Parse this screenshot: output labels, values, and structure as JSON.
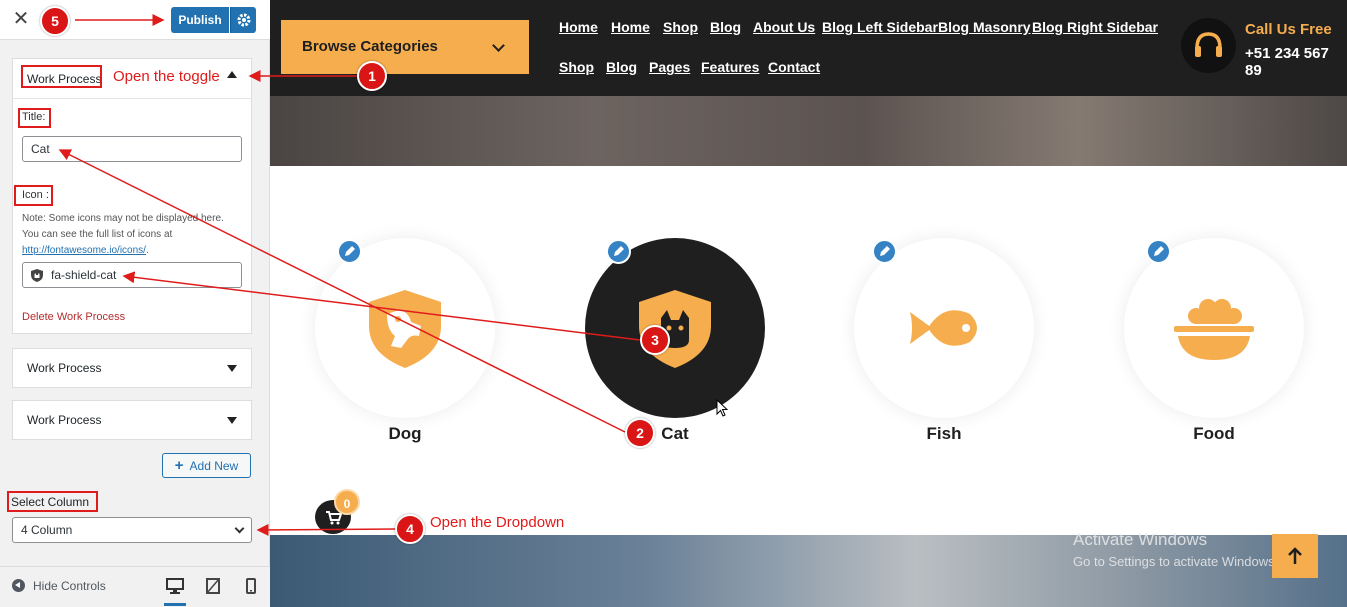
{
  "panel": {
    "close_glyph": "✕",
    "publish_label": "Publish",
    "open_section": {
      "title": "Work Process",
      "title_label": "Title:",
      "title_value": "Cat",
      "icon_label": "Icon :",
      "note_line1": "Note: Some icons may not be displayed here.",
      "note_line2": "You can see the full list of icons at",
      "note_link": "http://fontawesome.io/icons/",
      "note_link_suffix": ".",
      "icon_value": "fa-shield-cat",
      "delete_label": "Delete Work Process"
    },
    "collapsed_sections": [
      "Work Process",
      "Work Process"
    ],
    "add_new_label": "Add New",
    "select_column_label": "Select Column",
    "select_column_value": "4 Column",
    "hide_controls_label": "Hide Controls"
  },
  "site": {
    "browse_categories": "Browse Categories",
    "nav_row1": [
      "Home",
      "Home",
      "Shop",
      "Blog",
      "About Us",
      "Blog Left Sidebar",
      "Blog Masonry",
      "Blog Right Sidebar"
    ],
    "nav_row2": [
      "Shop",
      "Blog",
      "Pages",
      "Features",
      "Contact"
    ],
    "call_label": "Call Us Free",
    "call_number": "+51 234 567 89",
    "categories": [
      {
        "name": "Dog",
        "icon": "shield-dog-icon"
      },
      {
        "name": "Cat",
        "icon": "shield-cat-icon"
      },
      {
        "name": "Fish",
        "icon": "fish-icon"
      },
      {
        "name": "Food",
        "icon": "bowl-food-icon"
      }
    ],
    "cart_count": "0",
    "watermark_line1": "Activate Windows",
    "watermark_line2": "Go to Settings to activate Windows."
  },
  "annotations": [
    {
      "number": "1",
      "text": "Open the toggle"
    },
    {
      "number": "2",
      "text": ""
    },
    {
      "number": "3",
      "text": ""
    },
    {
      "number": "4",
      "text": "Open the Dropdown"
    },
    {
      "number": "5",
      "text": ""
    }
  ],
  "colors": {
    "accent_orange": "#f6ad4e",
    "dark": "#1f1f1f",
    "wp_blue": "#2271b1",
    "annotation_red": "#e01b1b"
  }
}
